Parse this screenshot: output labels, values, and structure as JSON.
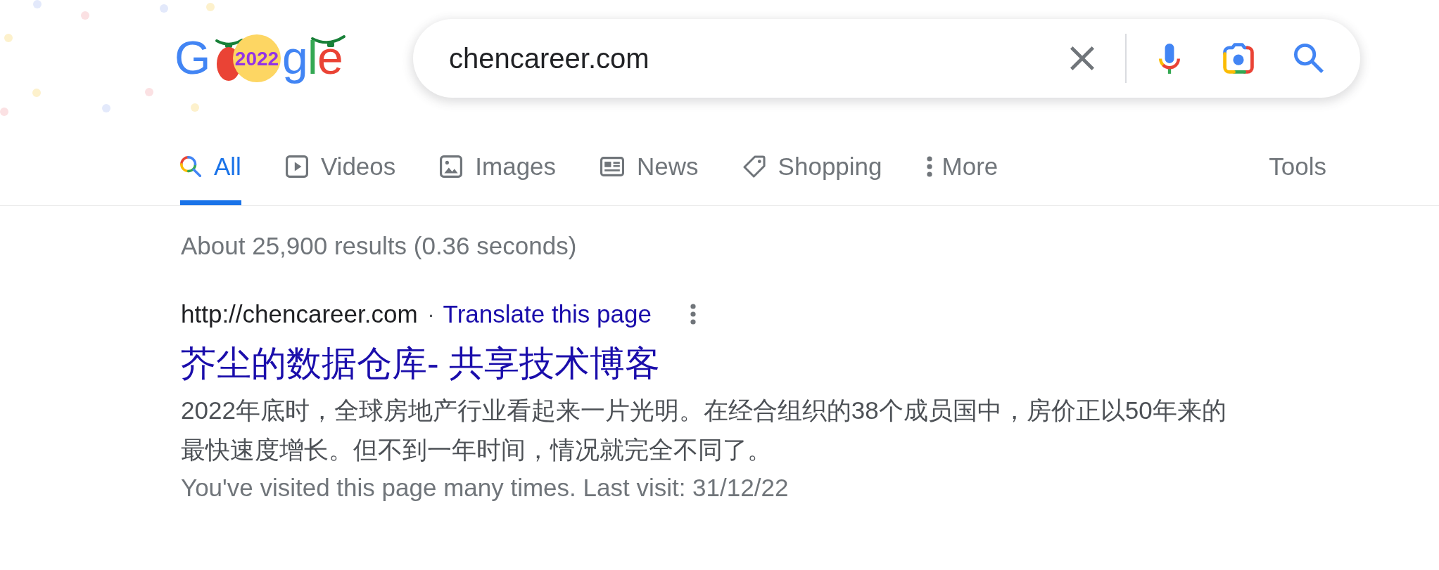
{
  "logo": {
    "letters": [
      "G",
      "g",
      "l",
      "e"
    ],
    "badge": "2022"
  },
  "search": {
    "value": "chencareer.com"
  },
  "tabs": [
    {
      "label": "All",
      "selected": true
    },
    {
      "label": "Videos",
      "selected": false
    },
    {
      "label": "Images",
      "selected": false
    },
    {
      "label": "News",
      "selected": false
    },
    {
      "label": "Shopping",
      "selected": false
    },
    {
      "label": "More",
      "selected": false
    }
  ],
  "tools": "Tools",
  "result_stats": "About 25,900 results (0.36 seconds)",
  "results": [
    {
      "url": "http://chencareer.com",
      "separator": "·",
      "translate_link": "Translate this page",
      "title": "芥尘的数据仓库- 共享技术博客",
      "snippet": "2022年底时，全球房地产行业看起来一片光明。在经合组织的38个成员国中，房价正以50年来的最快速度增长。但不到一年时间，情况就完全不同了。",
      "visited_note": "You've visited this page many times. Last visit: 31/12/22"
    }
  ]
}
